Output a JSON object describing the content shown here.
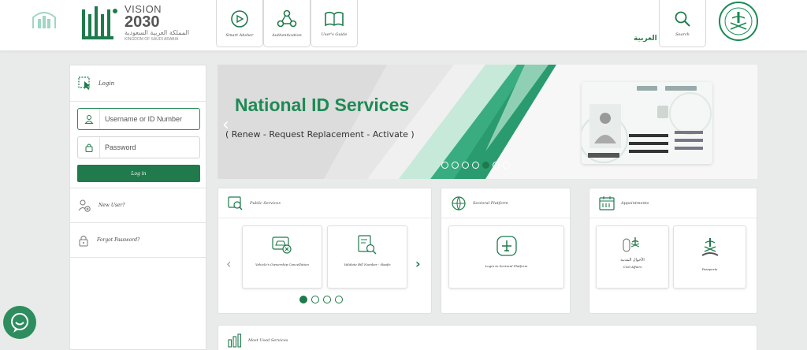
{
  "header": {
    "vision": {
      "line1": "VISION",
      "line2": "2030",
      "arabic": "المملكة العربية السعودية",
      "kingdom": "KINGDOM OF SAUDI ARABIA"
    },
    "boxes": [
      {
        "label": "Smart Absher"
      },
      {
        "label": "Authentication"
      },
      {
        "label": "User's Guide"
      }
    ],
    "arabic_link": "العربية",
    "search_label": "Search"
  },
  "sidebar": {
    "login_title": "Login",
    "username_placeholder": "Username or ID Number",
    "password_placeholder": "Password",
    "login_button": "Log in",
    "new_user": "New User?",
    "forgot_password": "Forgot Password?"
  },
  "banner": {
    "title": "National ID Services",
    "subtitle": "( Renew - Request Replacement - Activate )",
    "slide_count": 7,
    "active_slide": 5
  },
  "public_services": {
    "title": "Public Services",
    "items": [
      {
        "label": "Vehicle's Ownership Cancellation"
      },
      {
        "label": "Validate Bill Number - Haafiz"
      }
    ],
    "page_count": 4,
    "active_page": 1
  },
  "sectoral": {
    "title": "Sectoral Platform",
    "item_label": "Login to Sectoral Platform"
  },
  "appointments": {
    "title": "Appointments",
    "items": [
      {
        "label": "Civil Affairs",
        "arabic": "الأحوال المدنية"
      },
      {
        "label": "Passports"
      }
    ]
  },
  "most_used": {
    "title": "Most Used Services"
  },
  "colors": {
    "brand_green": "#1e7a4c",
    "accent_green": "#1e8a55"
  }
}
